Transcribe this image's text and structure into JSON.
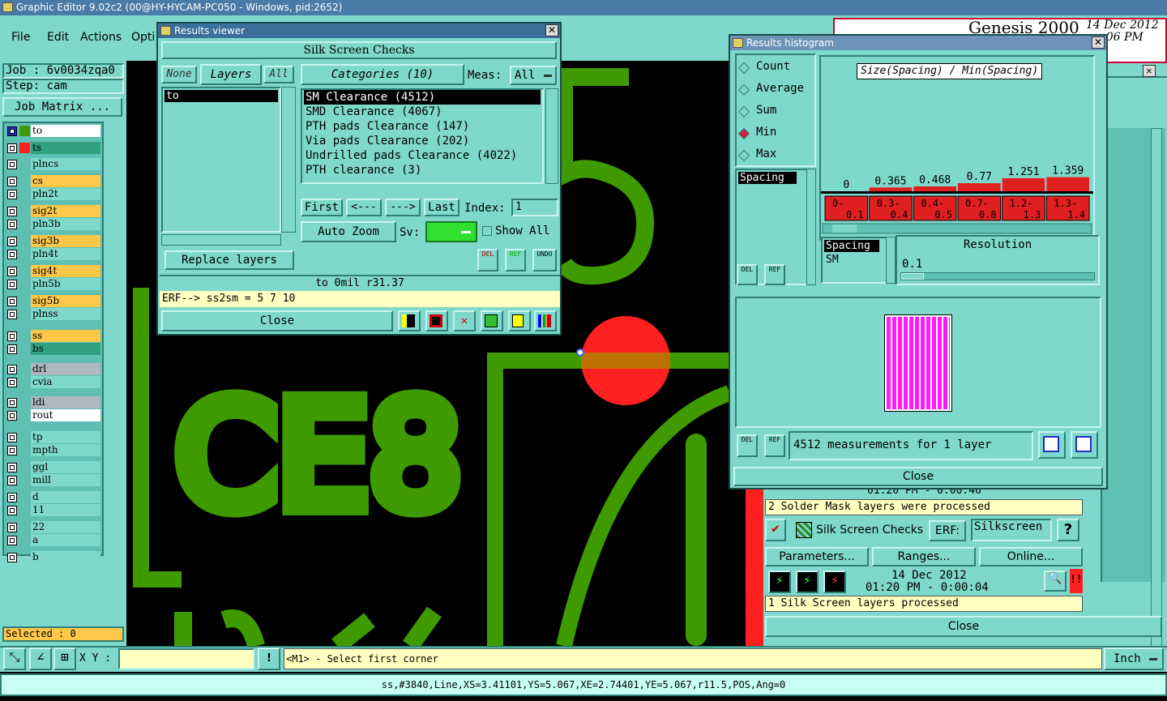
{
  "app": {
    "title": "Graphic Editor 9.02c2 (00@HY-HYCAM-PC050 - Windows, pid:2652)",
    "menu": [
      "File",
      "Edit",
      "Actions",
      "Opti"
    ],
    "brand": "Genesis 2000",
    "date": "14 Dec 2012",
    "time": ":06 PM"
  },
  "job": {
    "job_label": "Job : 6v0034zqa0",
    "step_label": "Step: cam",
    "job_matrix": "Job Matrix ...",
    "selected": "Selected : 0"
  },
  "layers": [
    {
      "name": "to",
      "style": "w"
    },
    {
      "name": "ts",
      "style": "gr"
    },
    {
      "name": "plncs",
      "style": "g"
    },
    {
      "name": "cs",
      "style": "o"
    },
    {
      "name": "pln2t",
      "style": "g"
    },
    {
      "name": "sig2t",
      "style": "o"
    },
    {
      "name": "pln3b",
      "style": "g"
    },
    {
      "name": "sig3b",
      "style": "o"
    },
    {
      "name": "pln4t",
      "style": "g"
    },
    {
      "name": "sig4t",
      "style": "o"
    },
    {
      "name": "pln5b",
      "style": "g"
    },
    {
      "name": "sig5b",
      "style": "o"
    },
    {
      "name": "plnss",
      "style": "g"
    },
    {
      "name": "ss",
      "style": "o"
    },
    {
      "name": "bs",
      "style": "gr"
    },
    {
      "name": "drl",
      "style": "s"
    },
    {
      "name": "cvia",
      "style": "g"
    },
    {
      "name": "ldi",
      "style": "s"
    },
    {
      "name": "rout",
      "style": "w"
    },
    {
      "name": "tp",
      "style": "g"
    },
    {
      "name": "mpth",
      "style": "g"
    },
    {
      "name": "ggl",
      "style": "g"
    },
    {
      "name": "mill",
      "style": "g"
    },
    {
      "name": "d",
      "style": "g"
    },
    {
      "name": "11",
      "style": "g"
    },
    {
      "name": "22",
      "style": "g"
    },
    {
      "name": "a",
      "style": "g"
    },
    {
      "name": "b",
      "style": "g"
    }
  ],
  "canvas": {
    "text1": "CE8",
    "text2": "5"
  },
  "results_viewer": {
    "title": "Results viewer",
    "header": "Silk Screen Checks",
    "btn_none": "None",
    "btn_layers": "Layers",
    "btn_all": "All",
    "layer_items": [
      "to"
    ],
    "categories_label": "Categories (10)",
    "meas_label": "Meas:",
    "meas_value": "All",
    "categories": [
      "SM Clearance (4512)",
      "SMD Clearance (4067)",
      "PTH pads Clearance (147)",
      "Via pads Clearance (202)",
      "Undrilled pads Clearance (4022)",
      "PTH clearance (3)"
    ],
    "btn_first": "First",
    "btn_prev": "<---",
    "btn_next": "--->",
    "btn_last": "Last",
    "index_label": "Index:",
    "index_value": "1",
    "auto_zoom": "Auto Zoom",
    "sv_label": "Sv:",
    "show_all": "Show All",
    "replace_layers": "Replace layers",
    "del": "DEL",
    "ref": "REF",
    "undo": "UNDO",
    "info_line": "to 0mil r31.37",
    "erf_line": "ERF--> ss2sm = 5 7 10",
    "close": "Close"
  },
  "histogram": {
    "title": "Results histogram",
    "radios": [
      "Count",
      "Average",
      "Sum",
      "Min",
      "Max"
    ],
    "selected_radio": "Min",
    "chart_title": "Size(Spacing) / Min(Spacing)",
    "list_item": "Spacing",
    "list2_items": [
      "Spacing",
      "SM"
    ],
    "resolution_label": "Resolution",
    "resolution_value": "0.1",
    "measurements": "4512 measurements for 1 layer",
    "close": "Close",
    "del": "DEL",
    "ref": "REF"
  },
  "chart_data": {
    "type": "bar",
    "title": "Size(Spacing) / Min(Spacing)",
    "categories": [
      "0-0.1",
      "0.3-0.4",
      "0.4-0.5",
      "0.7-0.8",
      "1.2-1.3",
      "1.3-1.4"
    ],
    "category_top": [
      "0-",
      "0.3-",
      "0.4-",
      "0.7-",
      "1.2-",
      "1.3-"
    ],
    "category_bottom": [
      "0.1",
      "0.4",
      "0.5",
      "0.8",
      "1.3",
      "1.4"
    ],
    "values": [
      0,
      0.365,
      0.468,
      0.77,
      1.251,
      1.359
    ],
    "value_labels": [
      "0",
      "0.365",
      "0.468",
      "0.77",
      "1.251",
      "1.359"
    ],
    "ylim": [
      0,
      1.4
    ],
    "color": "#e02020"
  },
  "checklist": {
    "row1_time": "01:20 PM - 0:00:46",
    "sm_processed": "2 Solder Mask layers were processed",
    "silk_title": "Silk Screen Checks",
    "erf_label": "ERF:",
    "erf_value": "Silkscreen",
    "help": "?",
    "parameters": "Parameters...",
    "ranges": "Ranges...",
    "online": "Online...",
    "date": "14 Dec 2012",
    "time": "01:20 PM - 0:00:04",
    "silk_processed": "1 Silk Screen layers processed",
    "close": "Close"
  },
  "bottom": {
    "xy_label": "X Y :",
    "prompt": "<M1> - Select first corner",
    "units": "Inch",
    "status": "ss,#3840,Line,XS=3.41101,YS=5.067,XE=2.74401,YE=5.067,r11.5,POS,Ang=0"
  },
  "colors": {
    "panel": "#7fd8cc",
    "feature_green": "#3f9a00",
    "highlight_red": "#ff2020",
    "histogram_fill": "#ff00ff",
    "title_blue": "#3a6f9a"
  }
}
